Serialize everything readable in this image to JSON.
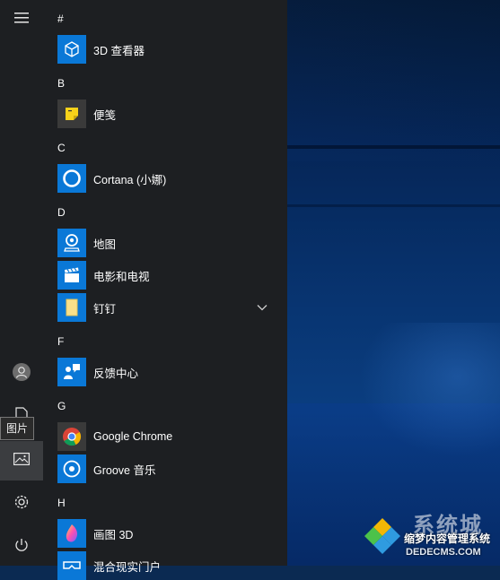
{
  "desktop": {
    "wallpaper": "windows-10-hero-blue"
  },
  "rail": {
    "items": [
      {
        "icon": "hamburger-menu-icon"
      },
      {
        "icon": "user-avatar-icon"
      },
      {
        "icon": "document-icon"
      },
      {
        "icon": "pictures-icon"
      },
      {
        "icon": "gear-icon"
      },
      {
        "icon": "power-icon"
      }
    ],
    "tooltip": "图片"
  },
  "app_list": {
    "groups": [
      {
        "letter": "#",
        "apps": [
          {
            "label": "3D 查看器",
            "icon": "3d-viewer-icon"
          }
        ]
      },
      {
        "letter": "B",
        "apps": [
          {
            "label": "便笺",
            "icon": "sticky-notes-icon"
          }
        ]
      },
      {
        "letter": "C",
        "apps": [
          {
            "label": "Cortana (小娜)",
            "icon": "cortana-icon"
          }
        ]
      },
      {
        "letter": "D",
        "apps": [
          {
            "label": "地图",
            "icon": "maps-icon"
          },
          {
            "label": "电影和电视",
            "icon": "movies-tv-icon"
          },
          {
            "label": "钉钉",
            "icon": "folder-icon",
            "expandable": true
          }
        ]
      },
      {
        "letter": "F",
        "apps": [
          {
            "label": "反馈中心",
            "icon": "feedback-hub-icon"
          }
        ]
      },
      {
        "letter": "G",
        "apps": [
          {
            "label": "Google Chrome",
            "icon": "chrome-icon"
          },
          {
            "label": "Groove 音乐",
            "icon": "groove-music-icon"
          }
        ]
      },
      {
        "letter": "H",
        "apps": [
          {
            "label": "画图 3D",
            "icon": "paint-3d-icon"
          },
          {
            "label": "混合现实门户",
            "icon": "mixed-reality-icon"
          }
        ]
      }
    ]
  },
  "watermark": {
    "big_text": "系统城",
    "line1": "缩梦内容管理系统",
    "line2": "DEDECMS.COM"
  },
  "colors": {
    "menu_bg": "#1d1f22",
    "accent": "#0a78d7",
    "text": "#ffffff"
  }
}
